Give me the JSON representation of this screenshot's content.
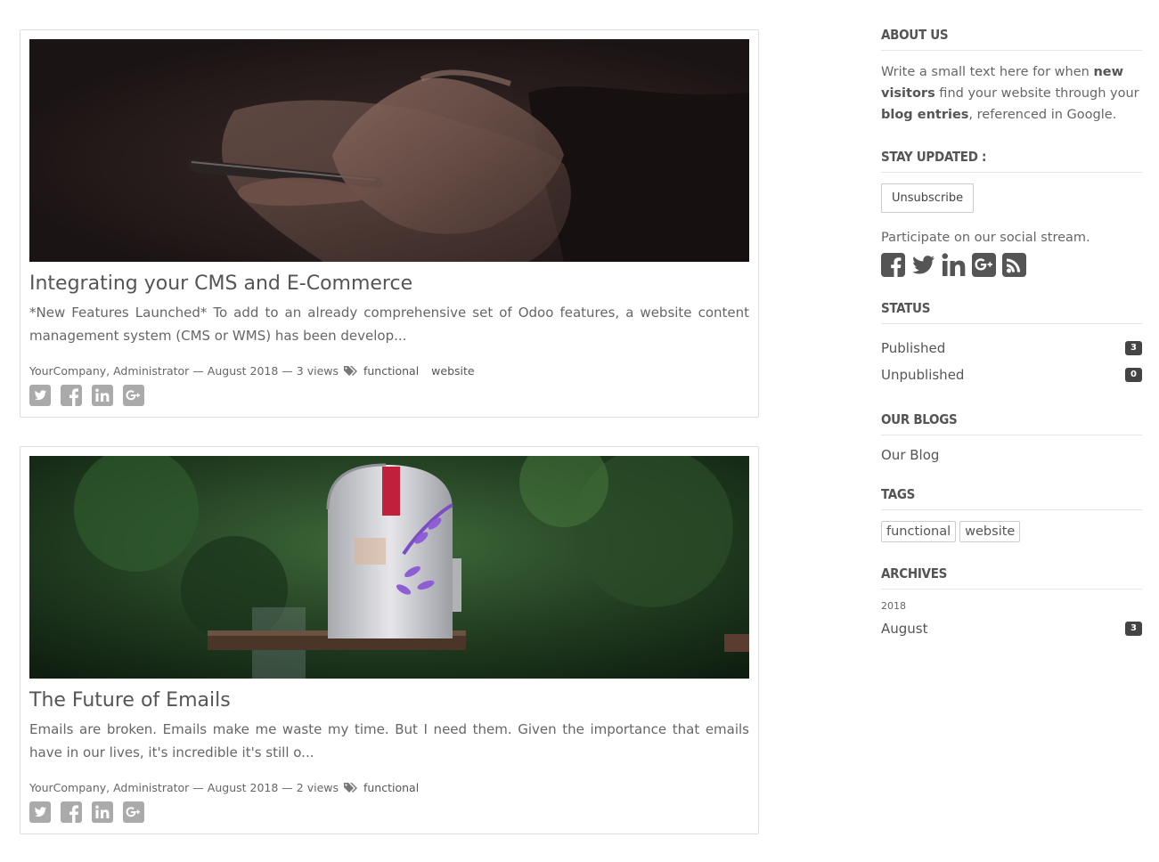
{
  "posts": [
    {
      "title": "Integrating your CMS and E-Commerce",
      "teaser": "*New Features Launched* To add to an already comprehensive set of Odoo features, a website content management system (CMS or WMS) has been develop...",
      "author": "YourCompany, Administrator",
      "date": "August 2018",
      "views": "3 views",
      "tags": [
        "functional",
        "website"
      ],
      "cover": "hand holding smartphone on dark background",
      "share_icons": [
        "twitter-icon",
        "facebook-icon",
        "linkedin-icon",
        "google-plus-icon"
      ]
    },
    {
      "title": "The Future of Emails",
      "teaser": "Emails are broken. Emails make me waste my time. But I need them. Given the importance that emails have in our lives, it's incredible it's still o...",
      "author": "YourCompany, Administrator",
      "date": "August 2018",
      "views": "2 views",
      "tags": [
        "functional"
      ],
      "cover": "white US Mail mailbox in front of green foliage",
      "share_icons": [
        "twitter-icon",
        "facebook-icon",
        "linkedin-icon",
        "google-plus-icon"
      ]
    }
  ],
  "meta_separator": "—",
  "sidebar": {
    "about": {
      "heading": "ABOUT US",
      "text_1": "Write a small text here for when ",
      "bold_1": "new visitors",
      "text_2": " find your website through your ",
      "bold_2": "blog entries",
      "text_3": ", referenced in Google."
    },
    "stay_updated": {
      "heading": "STAY UPDATED :",
      "button_label": "Unsubscribe",
      "social_text": "Participate on our social stream.",
      "social_icons": [
        "facebook-icon",
        "twitter-icon",
        "linkedin-icon",
        "google-plus-icon",
        "rss-icon"
      ]
    },
    "status": {
      "heading": "STATUS",
      "items": [
        {
          "label": "Published",
          "count": "3"
        },
        {
          "label": "Unpublished",
          "count": "0"
        }
      ]
    },
    "our_blogs": {
      "heading": "OUR BLOGS",
      "items": [
        "Our Blog"
      ]
    },
    "tags": {
      "heading": "TAGS",
      "items": [
        "functional",
        "website"
      ]
    },
    "archives": {
      "heading": "ARCHIVES",
      "year": "2018",
      "months": [
        {
          "label": "August",
          "count": "3"
        }
      ]
    }
  },
  "colors": {
    "text": "#666666",
    "heading": "#555555",
    "badge_bg": "#444444",
    "icon_gray": "#999999",
    "border": "#dddddd"
  }
}
